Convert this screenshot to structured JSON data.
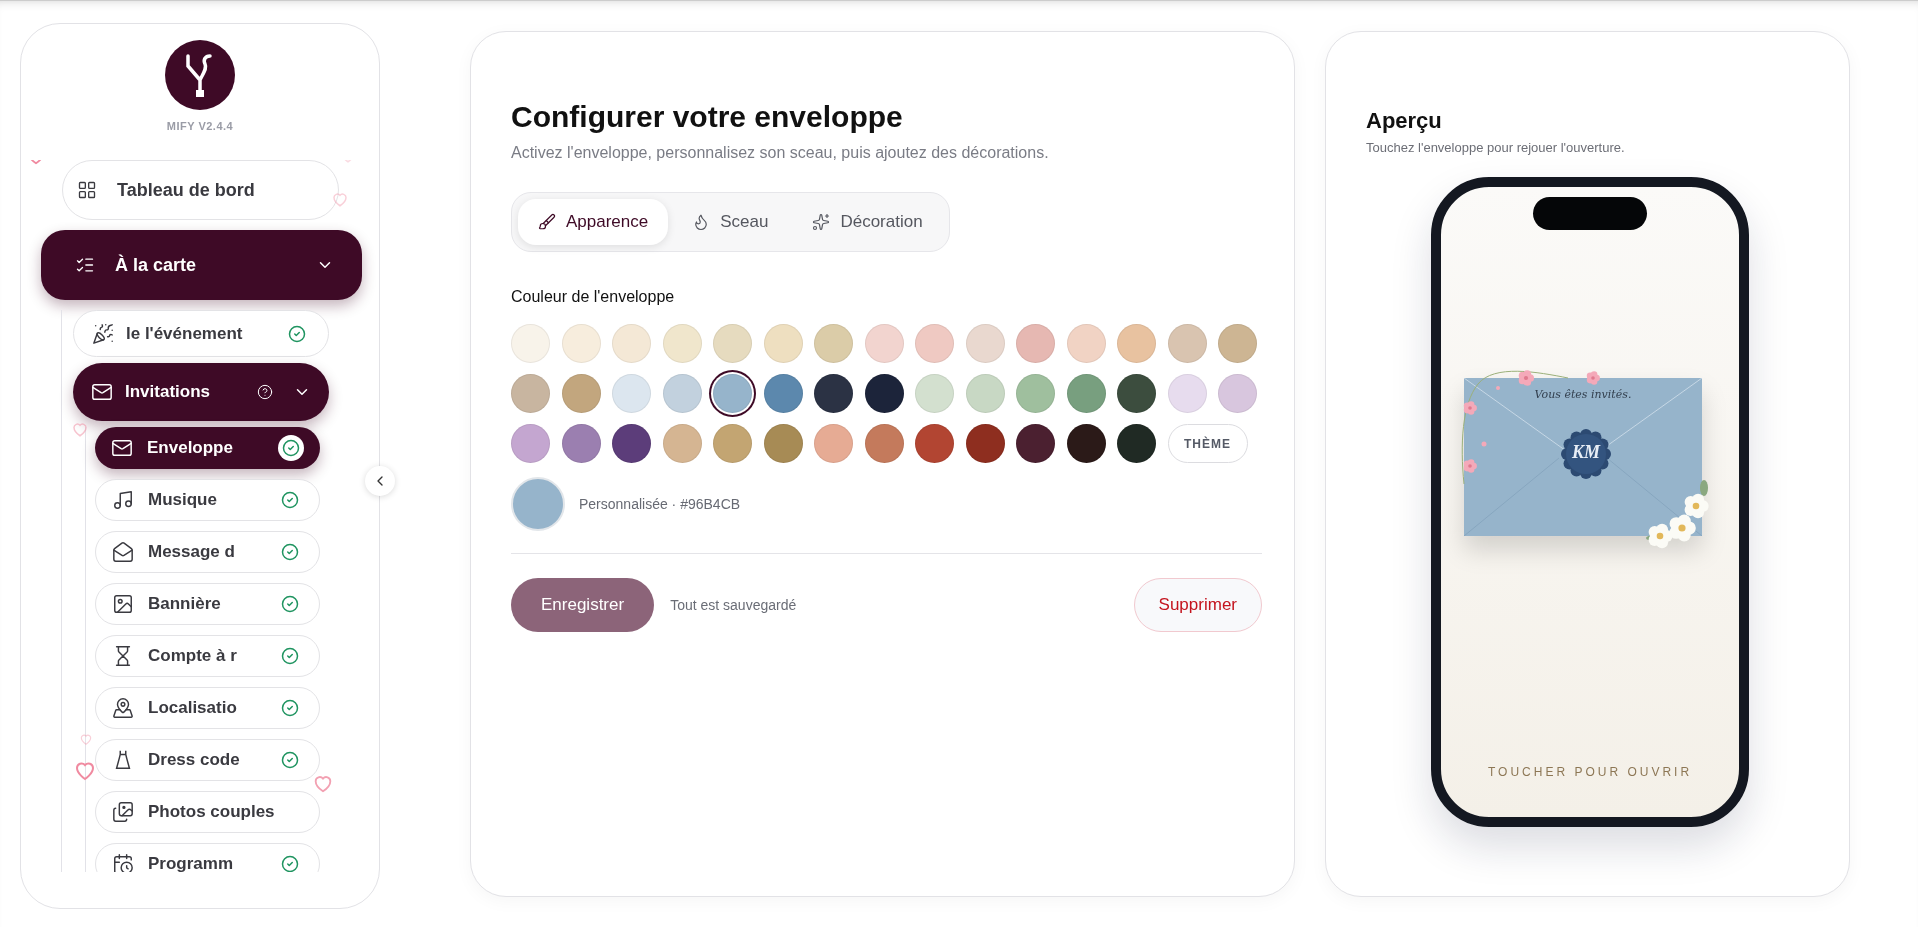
{
  "sidebar": {
    "version": "MIFY V2.4.4",
    "items": [
      {
        "label": "Tableau de bord",
        "selected": false
      },
      {
        "label": "À la carte",
        "selected": true,
        "expanded": true,
        "children": [
          {
            "label": "le l'événement",
            "selected": false,
            "done": true
          },
          {
            "label": "Invitations",
            "selected": true,
            "expanded": true,
            "help": true,
            "children": [
              {
                "label": "Enveloppe",
                "selected": true,
                "done": true
              },
              {
                "label": "Musique",
                "selected": false,
                "done": true
              },
              {
                "label": "Message d",
                "selected": false,
                "done": true
              },
              {
                "label": "Bannière",
                "selected": false,
                "done": true
              },
              {
                "label": "Compte à r",
                "selected": false,
                "done": true
              },
              {
                "label": "Localisatio",
                "selected": false,
                "done": true
              },
              {
                "label": "Dress code",
                "selected": false,
                "done": true
              },
              {
                "label": "Photos couples",
                "selected": false,
                "done": false
              },
              {
                "label": "Programm",
                "selected": false,
                "done": true
              }
            ]
          }
        ]
      }
    ]
  },
  "editor": {
    "title": "Configurer votre enveloppe",
    "subtitle": "Activez l'enveloppe, personnalisez son sceau, puis ajoutez des décorations.",
    "tabs": [
      {
        "label": "Apparence",
        "selected": true
      },
      {
        "label": "Sceau",
        "selected": false
      },
      {
        "label": "Décoration",
        "selected": false
      }
    ],
    "section_label": "Couleur de l'enveloppe",
    "swatches": [
      {
        "color": "#f8f3ea",
        "selected": false
      },
      {
        "color": "#f7eddd",
        "selected": false
      },
      {
        "color": "#f4e8d6",
        "selected": false
      },
      {
        "color": "#f0e6cc",
        "selected": false
      },
      {
        "color": "#e6dbbf",
        "selected": false
      },
      {
        "color": "#eedfc0",
        "selected": false
      },
      {
        "color": "#dbcca8",
        "selected": false
      },
      {
        "color": "#f2d4cf",
        "selected": false
      },
      {
        "color": "#efc9c2",
        "selected": false
      },
      {
        "color": "#e9d8cf",
        "selected": false
      },
      {
        "color": "#e6b8b2",
        "selected": false
      },
      {
        "color": "#f1d3c4",
        "selected": false
      },
      {
        "color": "#e8c2a0",
        "selected": false
      },
      {
        "color": "#d9c4b0",
        "selected": false
      },
      {
        "color": "#cdb593",
        "selected": false
      },
      {
        "color": "#c8b5a0",
        "selected": false
      },
      {
        "color": "#c2a67e",
        "selected": false
      },
      {
        "color": "#dce6ef",
        "selected": false
      },
      {
        "color": "#c2d1de",
        "selected": false
      },
      {
        "color": "#96b4cb",
        "selected": true
      },
      {
        "color": "#5c88ad",
        "selected": false
      },
      {
        "color": "#2b3244",
        "selected": false
      },
      {
        "color": "#1c243a",
        "selected": false
      },
      {
        "color": "#d3e0cf",
        "selected": false
      },
      {
        "color": "#c8d8c4",
        "selected": false
      },
      {
        "color": "#9fbf9e",
        "selected": false
      },
      {
        "color": "#789f7f",
        "selected": false
      },
      {
        "color": "#3c4d3e",
        "selected": false
      },
      {
        "color": "#e7dcee",
        "selected": false
      },
      {
        "color": "#d8c6de",
        "selected": false
      },
      {
        "color": "#c4a6d0",
        "selected": false
      },
      {
        "color": "#9b7fb0",
        "selected": false
      },
      {
        "color": "#5c3d7a",
        "selected": false
      },
      {
        "color": "#d5b592",
        "selected": false
      },
      {
        "color": "#c3a572",
        "selected": false
      },
      {
        "color": "#a78b55",
        "selected": false
      },
      {
        "color": "#e6ab94",
        "selected": false
      },
      {
        "color": "#c47a5c",
        "selected": false
      },
      {
        "color": "#b24532",
        "selected": false
      },
      {
        "color": "#8e2e1f",
        "selected": false
      },
      {
        "color": "#4b2030",
        "selected": false
      },
      {
        "color": "#2b1a18",
        "selected": false
      },
      {
        "color": "#202a24",
        "selected": false
      }
    ],
    "theme_button": "THÈME",
    "custom": {
      "color": "#96b4cb",
      "label": "Personnalisée · #96B4CB"
    },
    "save_button": "Enregistrer",
    "save_status": "Tout est sauvegardé",
    "delete_button": "Supprimer"
  },
  "preview": {
    "title": "Aperçu",
    "subtitle": "Touchez l'enveloppe pour rejouer l'ouverture.",
    "envelope": {
      "color": "#96b4cb",
      "greeting": "Vous êtes invités.",
      "monogram": "KM"
    },
    "cta": "TOUCHER POUR OUVRIR"
  }
}
